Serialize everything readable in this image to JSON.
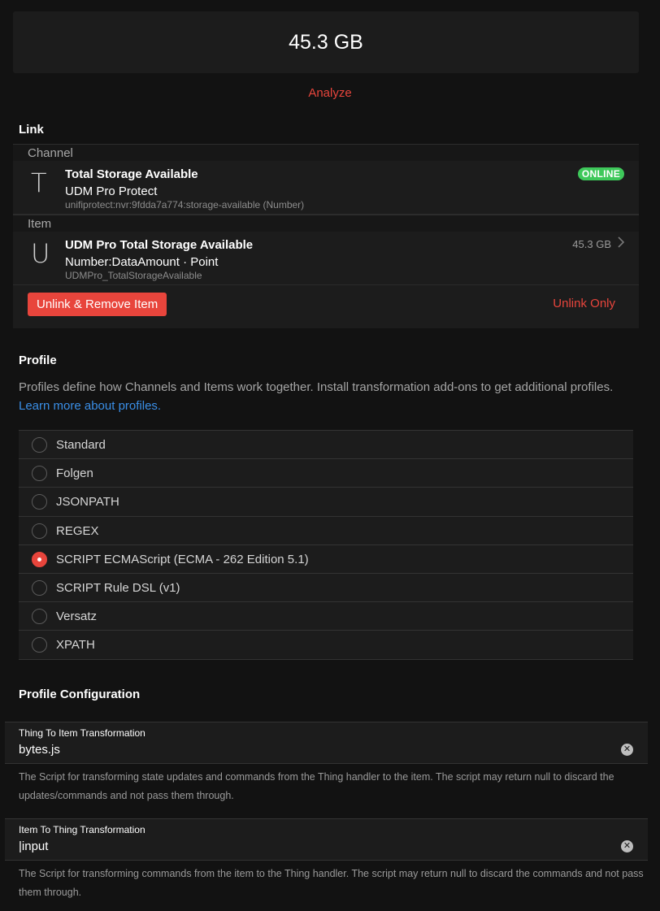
{
  "state": {
    "value": "45.3 GB"
  },
  "analyze_label": "Analyze",
  "link": {
    "title": "Link",
    "channel_header": "Channel",
    "channel": {
      "icon_letter": "T",
      "label": "Total Storage Available",
      "thing": "UDM Pro Protect",
      "uid": "unifiprotect:nvr:9fdda7a774:storage-available (Number)",
      "status": "ONLINE",
      "status_color": "#3ec85a"
    },
    "item_header": "Item",
    "item": {
      "icon_letter": "U",
      "label": "UDM Pro Total Storage Available",
      "type": "Number:DataAmount · Point",
      "name": "UDMPro_TotalStorageAvailable",
      "state": "45.3 GB"
    },
    "unlink_remove_label": "Unlink & Remove Item",
    "unlink_only_label": "Unlink Only"
  },
  "profile": {
    "title": "Profile",
    "description": "Profiles define how Channels and Items work together. Install transformation add-ons to get additional profiles. ",
    "learn_more": "Learn more about profiles.",
    "options": [
      {
        "label": "Standard",
        "selected": false
      },
      {
        "label": "Folgen",
        "selected": false
      },
      {
        "label": "JSONPATH",
        "selected": false
      },
      {
        "label": "REGEX",
        "selected": false
      },
      {
        "label": "SCRIPT ECMAScript (ECMA - 262 Edition 5.1)",
        "selected": true
      },
      {
        "label": "SCRIPT Rule DSL (v1)",
        "selected": false
      },
      {
        "label": "Versatz",
        "selected": false
      },
      {
        "label": "XPATH",
        "selected": false
      }
    ]
  },
  "config": {
    "title": "Profile Configuration",
    "fields": [
      {
        "label": "Thing To Item Transformation",
        "value": "bytes.js",
        "help": "The Script for transforming state updates and commands from the Thing handler to the item. The script may return null to discard the updates/commands and not pass them through."
      },
      {
        "label": "Item To Thing Transformation",
        "value": "|input",
        "help": "The Script for transforming commands from the item to the Thing handler. The script may return null to discard the commands and not pass them through."
      }
    ]
  },
  "colors": {
    "accent": "#e8453c",
    "link": "#3a8ee6",
    "online": "#3ec85a"
  }
}
